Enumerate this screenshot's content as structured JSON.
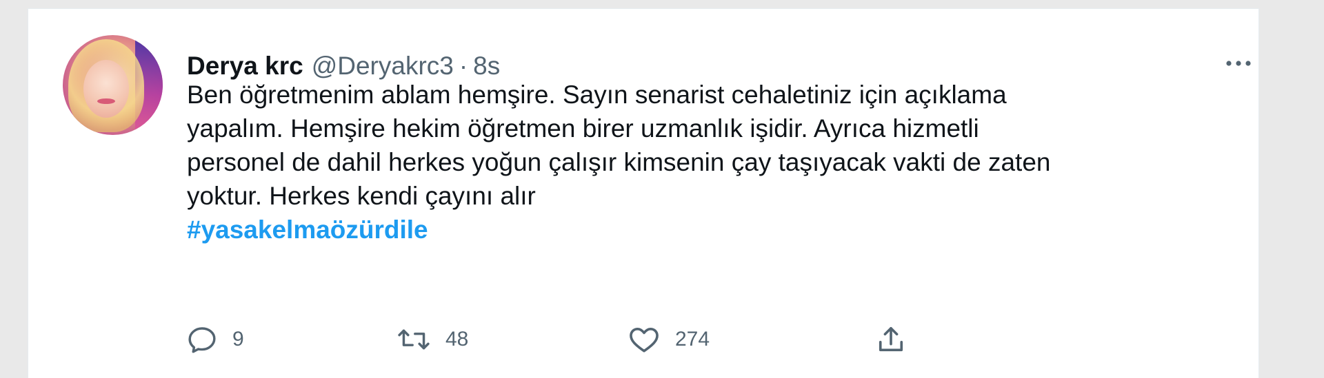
{
  "tweet": {
    "author": {
      "display_name": "Derya krc",
      "handle": "@Deryakrc3"
    },
    "separator": "·",
    "time": "8s",
    "text_lines": [
      "Ben öğretmenim ablam hemşire. Sayın senarist cehaletiniz için açıklama",
      "yapalım. Hemşire hekim öğretmen birer uzmanlık işidir. Ayrıca hizmetli",
      "personel de dahil herkes yoğun çalışır kimsenin çay taşıyacak vakti de zaten",
      "yoktur. Herkes kendi çayını alır"
    ],
    "hashtag": "#yasakelmaözürdile",
    "more_icon": "more-dots-icon",
    "actions": {
      "reply": {
        "icon": "reply-icon",
        "count": "9"
      },
      "retweet": {
        "icon": "retweet-icon",
        "count": "48"
      },
      "like": {
        "icon": "heart-icon",
        "count": "274"
      },
      "share": {
        "icon": "share-icon"
      }
    }
  },
  "colors": {
    "text_primary": "#0f1419",
    "text_secondary": "#536471",
    "link": "#1d9bf0",
    "icon": "#536471",
    "background_outer": "#e9e9e9",
    "card": "#ffffff"
  }
}
